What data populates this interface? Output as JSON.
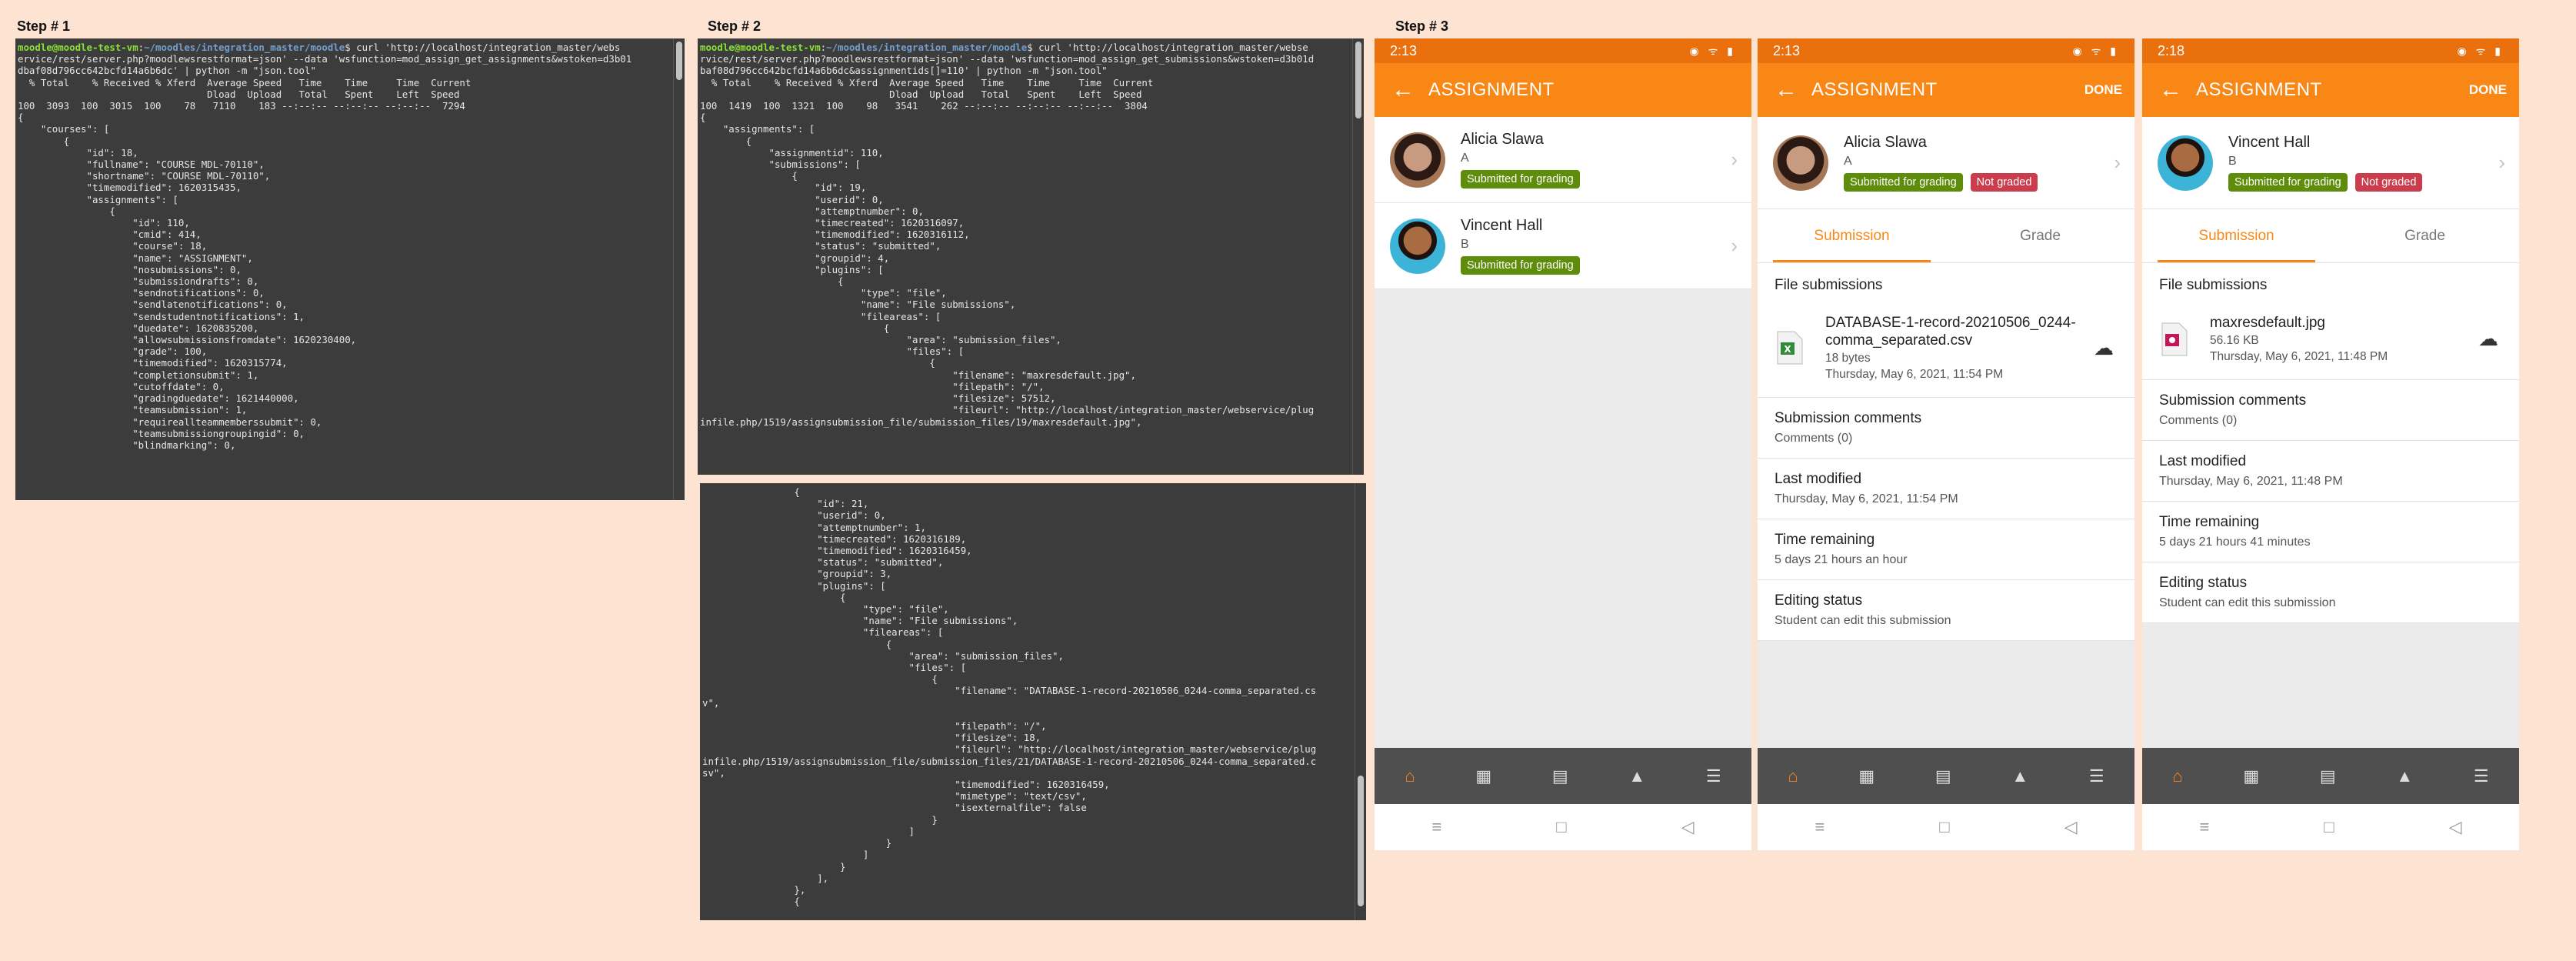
{
  "steps": {
    "s1": "Step # 1",
    "s2": "Step # 2",
    "s3": "Step # 3"
  },
  "terminal1": {
    "prompt_user": "moodle@moodle-test-vm",
    "prompt_path": "~/moodles/integration_master/moodle",
    "command": "$ curl 'http://localhost/integration_master/webs\nervice/rest/server.php?moodlewsrestformat=json' --data 'wsfunction=mod_assign_get_assignments&wstoken=d3b01\ndbaf08d796cc642bcfd14a6b6dc' | python -m \"json.tool\"",
    "body": "  % Total    % Received % Xferd  Average Speed   Time    Time     Time  Current\n                                 Dload  Upload   Total   Spent    Left  Speed\n100  3093  100  3015  100    78   7110    183 --:--:-- --:--:-- --:--:--  7294\n{\n    \"courses\": [\n        {\n            \"id\": 18,\n            \"fullname\": \"COURSE MDL-70110\",\n            \"shortname\": \"COURSE MDL-70110\",\n            \"timemodified\": 1620315435,\n            \"assignments\": [\n                {\n                    \"id\": 110,\n                    \"cmid\": 414,\n                    \"course\": 18,\n                    \"name\": \"ASSIGNMENT\",\n                    \"nosubmissions\": 0,\n                    \"submissiondrafts\": 0,\n                    \"sendnotifications\": 0,\n                    \"sendlatenotifications\": 0,\n                    \"sendstudentnotifications\": 1,\n                    \"duedate\": 1620835200,\n                    \"allowsubmissionsfromdate\": 1620230400,\n                    \"grade\": 100,\n                    \"timemodified\": 1620315774,\n                    \"completionsubmit\": 1,\n                    \"cutoffdate\": 0,\n                    \"gradingduedate\": 1621440000,\n                    \"teamsubmission\": 1,\n                    \"requireallteammemberssubmit\": 0,\n                    \"teamsubmissiongroupingid\": 0,\n                    \"blindmarking\": 0,"
  },
  "terminal2": {
    "prompt_user": "moodle@moodle-test-vm",
    "prompt_path": "~/moodles/integration_master/moodle",
    "command": "$ curl 'http://localhost/integration_master/webse\nrvice/rest/server.php?moodlewsrestformat=json' --data 'wsfunction=mod_assign_get_submissions&wstoken=d3b01d\nbaf08d796cc642bcfd14a6b6dc&assignmentids[]=110' | python -m \"json.tool\"",
    "body": "  % Total    % Received % Xferd  Average Speed   Time    Time     Time  Current\n                                 Dload  Upload   Total   Spent    Left  Speed\n100  1419  100  1321  100    98   3541    262 --:--:-- --:--:-- --:--:--  3804\n{\n    \"assignments\": [\n        {\n            \"assignmentid\": 110,\n            \"submissions\": [\n                {\n                    \"id\": 19,\n                    \"userid\": 0,\n                    \"attemptnumber\": 0,\n                    \"timecreated\": 1620316097,\n                    \"timemodified\": 1620316112,\n                    \"status\": \"submitted\",\n                    \"groupid\": 4,\n                    \"plugins\": [\n                        {\n                            \"type\": \"file\",\n                            \"name\": \"File submissions\",\n                            \"fileareas\": [\n                                {\n                                    \"area\": \"submission_files\",\n                                    \"files\": [\n                                        {\n                                            \"filename\": \"maxresdefault.jpg\",\n                                            \"filepath\": \"/\",\n                                            \"filesize\": 57512,\n                                            \"fileurl\": \"http://localhost/integration_master/webservice/plug\ninfile.php/1519/assignsubmission_file/submission_files/19/maxresdefault.jpg\","
  },
  "terminal3": {
    "body": "                {\n                    \"id\": 21,\n                    \"userid\": 0,\n                    \"attemptnumber\": 1,\n                    \"timecreated\": 1620316189,\n                    \"timemodified\": 1620316459,\n                    \"status\": \"submitted\",\n                    \"groupid\": 3,\n                    \"plugins\": [\n                        {\n                            \"type\": \"file\",\n                            \"name\": \"File submissions\",\n                            \"fileareas\": [\n                                {\n                                    \"area\": \"submission_files\",\n                                    \"files\": [\n                                        {\n                                            \"filename\": \"DATABASE-1-record-20210506_0244-comma_separated.cs\nv\",\n\n                                            \"filepath\": \"/\",\n                                            \"filesize\": 18,\n                                            \"fileurl\": \"http://localhost/integration_master/webservice/plug\ninfile.php/1519/assignsubmission_file/submission_files/21/DATABASE-1-record-20210506_0244-comma_separated.c\nsv\",\n                                            \"timemodified\": 1620316459,\n                                            \"mimetype\": \"text/csv\",\n                                            \"isexternalfile\": false\n                                        }\n                                    ]\n                                }\n                            ]\n                        }\n                    ],\n                },\n                {"
  },
  "phone1": {
    "time": "2:13",
    "title": "ASSIGNMENT",
    "users": [
      {
        "name": "Alicia Slawa",
        "letter": "A",
        "badge": "Submitted for grading"
      },
      {
        "name": "Vincent Hall",
        "letter": "B",
        "badge": "Submitted for grading"
      }
    ]
  },
  "phone2": {
    "time": "2:13",
    "title": "ASSIGNMENT",
    "done": "DONE",
    "user": {
      "name": "Alicia Slawa",
      "letter": "A",
      "badge1": "Submitted for grading",
      "badge2": "Not graded"
    },
    "tabs": {
      "submission": "Submission",
      "grade": "Grade"
    },
    "file_submissions": "File submissions",
    "file": {
      "name": "DATABASE-1-record-20210506_0244-comma_separated.csv",
      "size": "18 bytes",
      "date": "Thursday, May 6, 2021, 11:54 PM"
    },
    "comments": {
      "h": "Submission comments",
      "s": "Comments (0)"
    },
    "modified": {
      "h": "Last modified",
      "s": "Thursday, May 6, 2021, 11:54 PM"
    },
    "remaining": {
      "h": "Time remaining",
      "s": "5 days 21 hours an hour"
    },
    "editing": {
      "h": "Editing status",
      "s": "Student can edit this submission"
    }
  },
  "phone3": {
    "time": "2:18",
    "title": "ASSIGNMENT",
    "done": "DONE",
    "user": {
      "name": "Vincent Hall",
      "letter": "B",
      "badge1": "Submitted for grading",
      "badge2": "Not graded"
    },
    "tabs": {
      "submission": "Submission",
      "grade": "Grade"
    },
    "file_submissions": "File submissions",
    "file": {
      "name": "maxresdefault.jpg",
      "size": "56.16 KB",
      "date": "Thursday, May 6, 2021, 11:48 PM"
    },
    "comments": {
      "h": "Submission comments",
      "s": "Comments (0)"
    },
    "modified": {
      "h": "Last modified",
      "s": "Thursday, May 6, 2021, 11:48 PM"
    },
    "remaining": {
      "h": "Time remaining",
      "s": "5 days 21 hours 41 minutes"
    },
    "editing": {
      "h": "Editing status",
      "s": "Student can edit this submission"
    }
  },
  "icons": {
    "back": "arrow-left-icon",
    "chevron": "chevron-right-icon",
    "download": "cloud-download-icon",
    "nav": [
      "home-icon",
      "calendar-icon",
      "messages-icon",
      "bell-icon",
      "menu-icon"
    ]
  }
}
